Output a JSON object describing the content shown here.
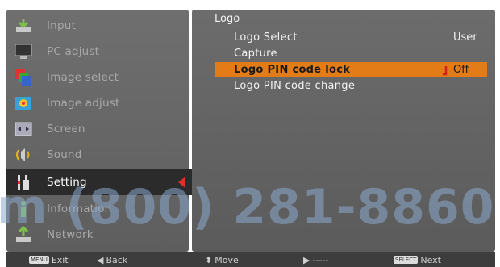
{
  "left_menu": {
    "items": [
      {
        "label": "Input",
        "icon": "input-icon"
      },
      {
        "label": "PC adjust",
        "icon": "pc-adjust-icon"
      },
      {
        "label": "Image select",
        "icon": "image-select-icon"
      },
      {
        "label": "Image adjust",
        "icon": "image-adjust-icon"
      },
      {
        "label": "Screen",
        "icon": "screen-icon"
      },
      {
        "label": "Sound",
        "icon": "sound-icon"
      },
      {
        "label": "Setting",
        "icon": "setting-icon"
      },
      {
        "label": "Information",
        "icon": "information-icon"
      },
      {
        "label": "Network",
        "icon": "network-icon"
      }
    ],
    "selected_index": 6
  },
  "submenu": {
    "title": "Logo",
    "rows": [
      {
        "label": "Logo Select",
        "value": "User"
      },
      {
        "label": "Capture",
        "value": ""
      },
      {
        "label": "Logo PIN code lock",
        "value": "Off"
      },
      {
        "label": "Logo PIN code change",
        "value": ""
      }
    ],
    "highlight_index": 2
  },
  "watermark": {
    "text": "m (800) 281-8860"
  },
  "bottom_bar": {
    "exit_key": "MENU",
    "exit_label": "Exit",
    "back_label": "Back",
    "move_label": "Move",
    "dashes_label": "-----",
    "next_key": "SELECT",
    "next_label": "Next"
  },
  "colors": {
    "highlight": "#e37b16",
    "panel": "#666666",
    "selected_item": "#2b2b2b",
    "arrow": "#e0302a",
    "watermark": "#8caacd"
  }
}
